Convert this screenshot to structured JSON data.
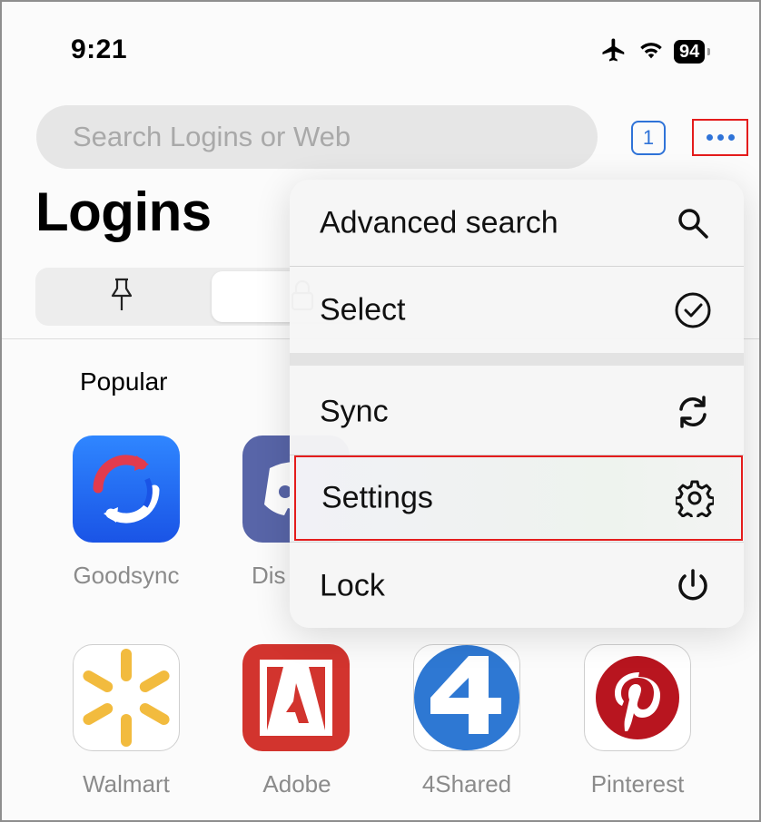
{
  "status_bar": {
    "time": "9:21",
    "battery": "94",
    "icons": [
      "airplane-icon",
      "wifi-icon",
      "battery-icon"
    ]
  },
  "search": {
    "placeholder": "Search Logins or Web"
  },
  "toolbar": {
    "tab_count": "1",
    "more_icon": "ellipsis-icon"
  },
  "page": {
    "title": "Logins"
  },
  "segmented": {
    "items": [
      "pin-icon",
      "lock-icon"
    ],
    "selected_index": 1
  },
  "section": {
    "label": "Popular"
  },
  "apps": [
    {
      "label": "Goodsync",
      "icon": "goodsync-icon"
    },
    {
      "label": "Dis",
      "icon": "discord-icon"
    },
    {
      "label": "Walmart",
      "icon": "walmart-icon"
    },
    {
      "label": "Adobe",
      "icon": "adobe-icon"
    },
    {
      "label": "4Shared",
      "icon": "4shared-icon"
    },
    {
      "label": "Pinterest",
      "icon": "pinterest-icon"
    }
  ],
  "menu": {
    "items": [
      {
        "label": "Advanced search",
        "icon": "search-icon"
      },
      {
        "label": "Select",
        "icon": "checkmark-circle-icon"
      },
      {
        "label": "Sync",
        "icon": "sync-icon"
      },
      {
        "label": "Settings",
        "icon": "gear-icon"
      },
      {
        "label": "Lock",
        "icon": "power-icon"
      }
    ]
  },
  "colors": {
    "accent": "#2f73d8",
    "highlight_border": "#e41c1c",
    "goodsync": "#1f6cf0",
    "discord": "#5865a8",
    "walmart_yellow": "#f2bb3e",
    "adobe": "#d2342e",
    "fourshared": "#2e78d3",
    "pinterest": "#b8151f"
  }
}
